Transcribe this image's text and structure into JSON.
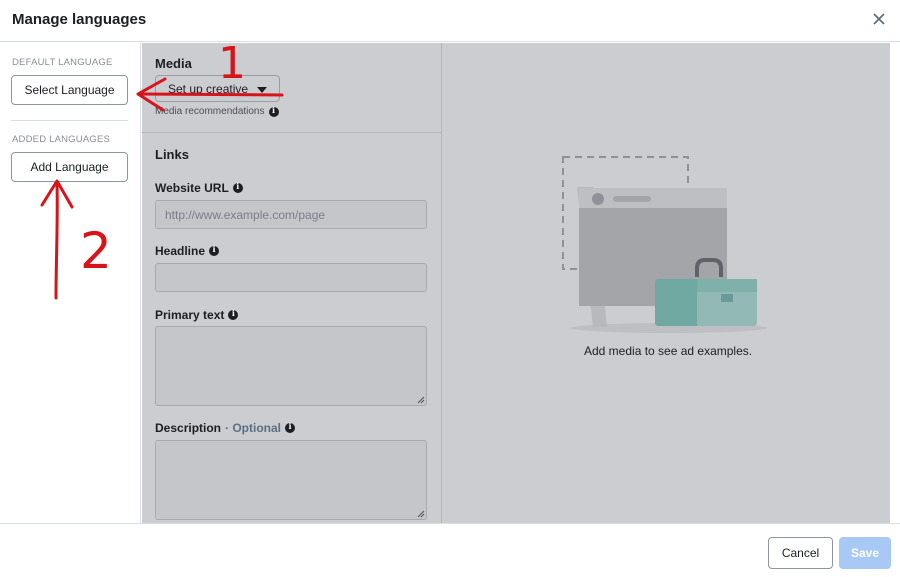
{
  "header": {
    "title": "Manage languages",
    "close_icon": "close-icon"
  },
  "sidebar": {
    "default_language_label": "DEFAULT LANGUAGE",
    "select_language_button": "Select Language",
    "added_languages_label": "ADDED LANGUAGES",
    "add_language_button": "Add Language"
  },
  "media": {
    "title": "Media",
    "setup_creative_button": "Set up creative",
    "recommendations": "Media recommendations"
  },
  "links": {
    "title": "Links",
    "website_url_label": "Website URL",
    "website_url_placeholder": "http://www.example.com/page",
    "website_url_value": "",
    "headline_label": "Headline",
    "headline_value": "",
    "primary_text_label": "Primary text",
    "primary_text_value": "",
    "description_label": "Description",
    "description_optional": "· Optional",
    "description_value": ""
  },
  "preview": {
    "caption": "Add media to see ad examples."
  },
  "footer": {
    "cancel_button": "Cancel",
    "save_button": "Save"
  },
  "annotations": {
    "mark_1": "1",
    "mark_2": "2",
    "color": "#d8141b"
  },
  "colors": {
    "gray_overlay": "#cbcdd1",
    "save_disabled": "#a8c8f5",
    "illustration_teal": "#6fa8a0",
    "illustration_gray": "#9a9ca0"
  }
}
